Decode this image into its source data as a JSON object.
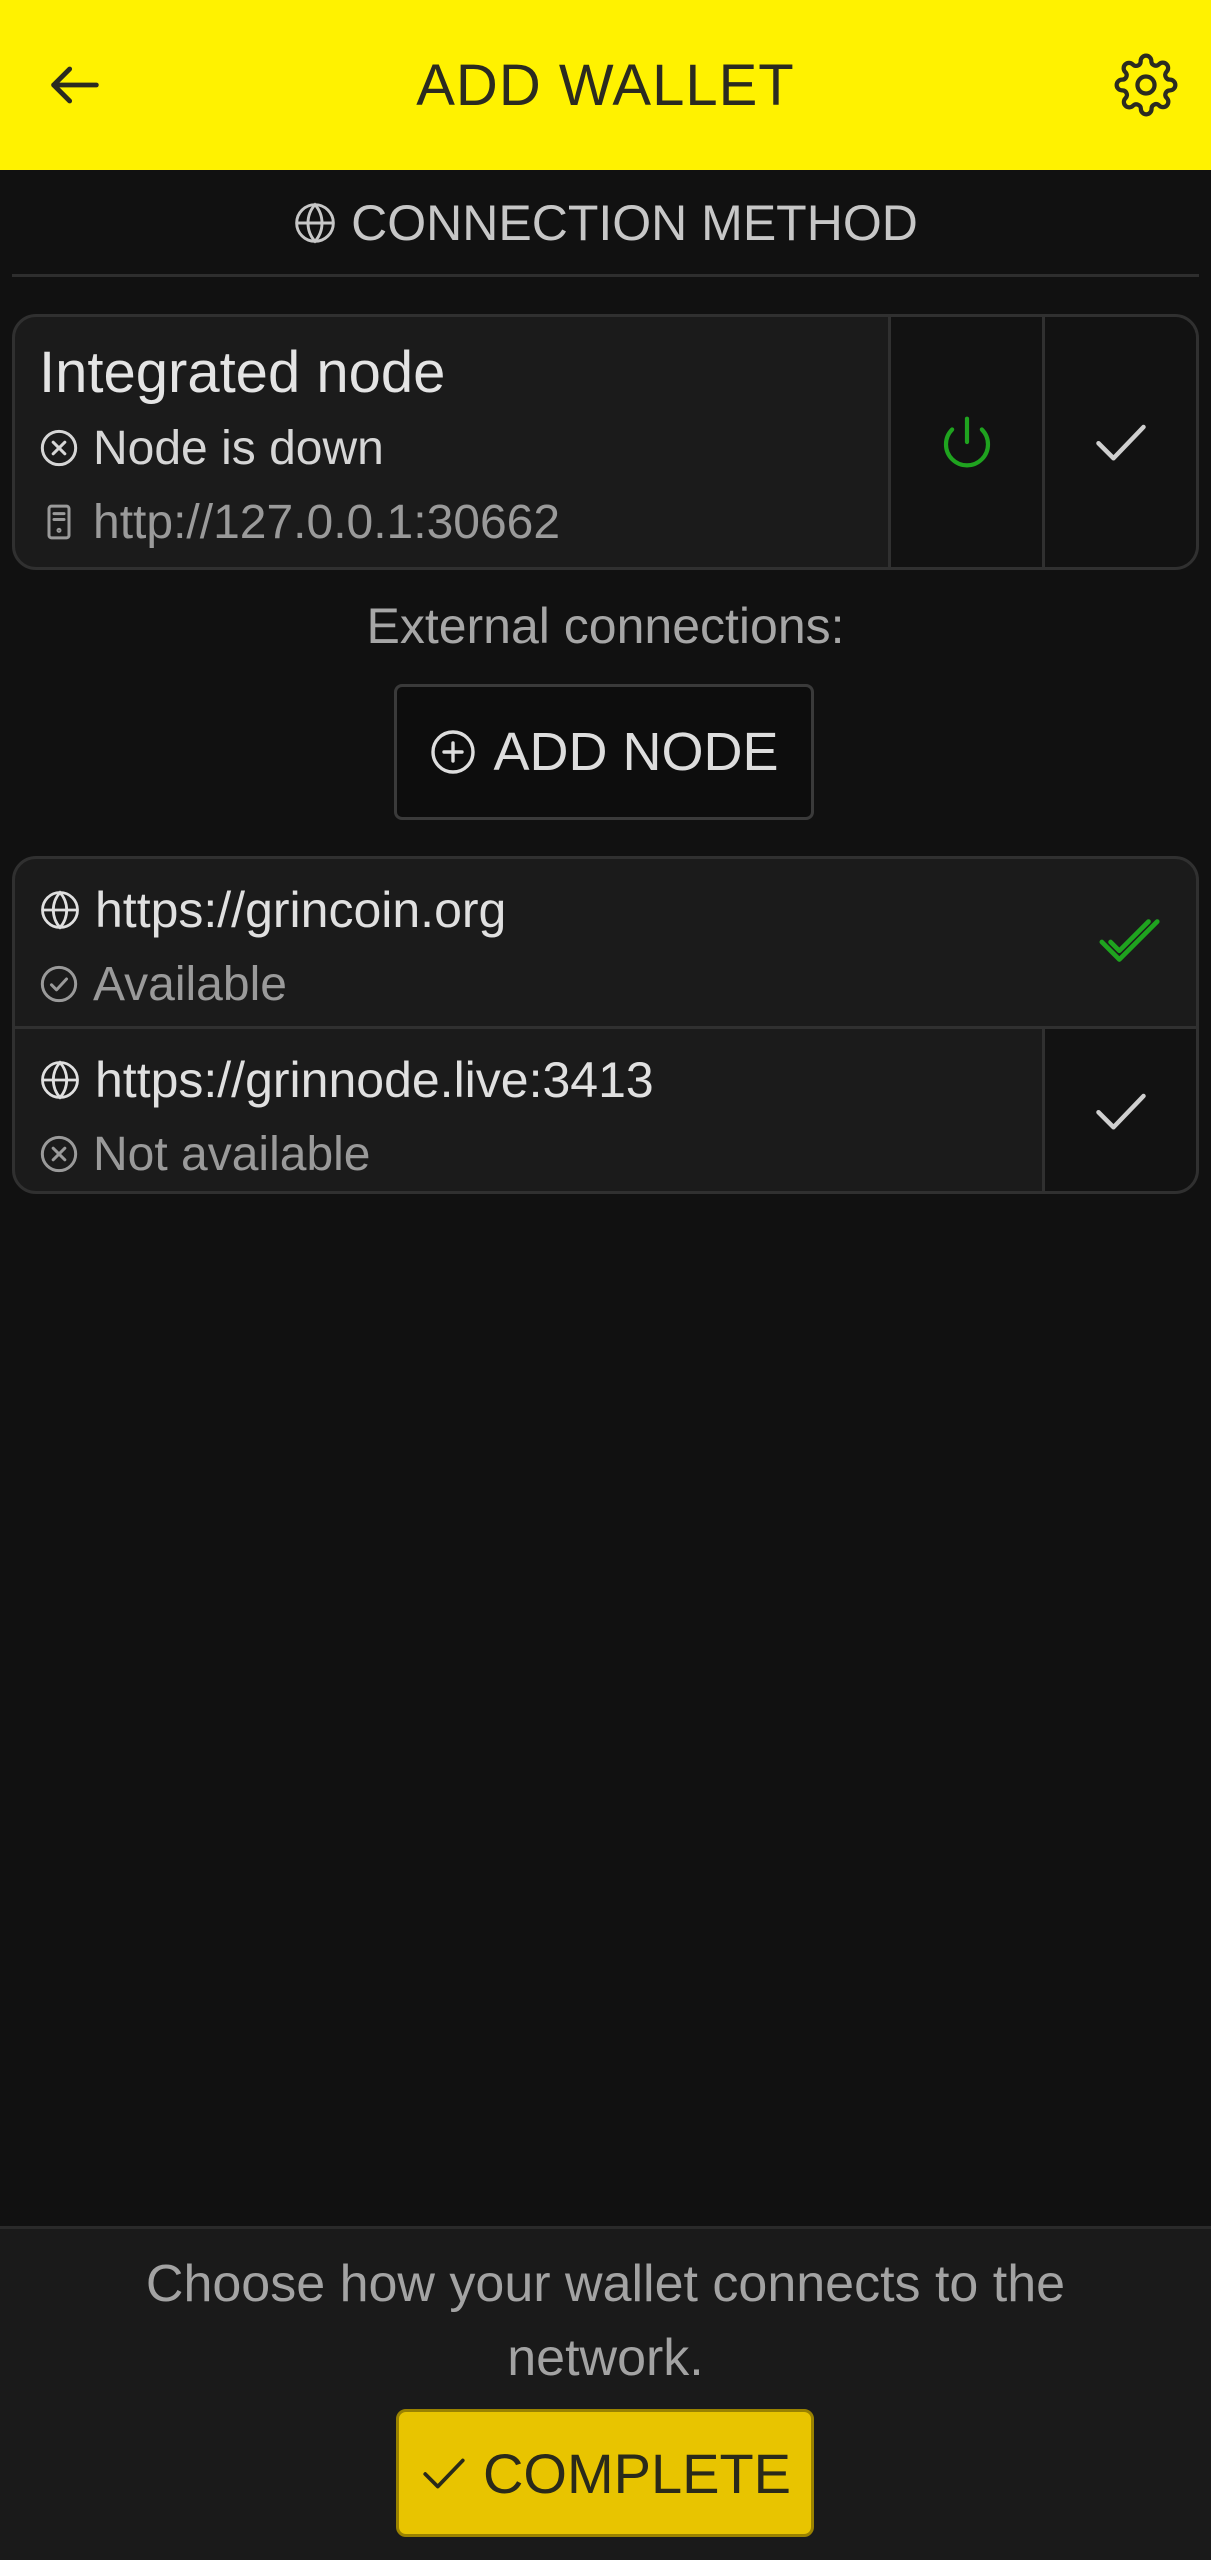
{
  "header": {
    "title": "ADD WALLET",
    "back_icon": "arrow-left-icon",
    "settings_icon": "gear-icon",
    "background": "#fff200"
  },
  "section": {
    "icon": "globe-icon",
    "title": "CONNECTION METHOD"
  },
  "integrated_node": {
    "title": "Integrated node",
    "status": "Node is down",
    "status_icon": "x-circle-icon",
    "address": "http://127.0.0.1:30662",
    "address_icon": "server-icon",
    "power_icon": "power-icon",
    "select_icon": "check-icon",
    "power_color": "#1fa31f"
  },
  "external": {
    "label": "External connections:",
    "add_button_label": "ADD NODE",
    "add_button_icon": "plus-circle-icon"
  },
  "nodes": [
    {
      "url": "https://grincoin.org",
      "status": "Available",
      "status_icon": "check-circle-icon",
      "selected": true,
      "check_color": "#1fa31f"
    },
    {
      "url": "https://grinnode.live:3413",
      "status": "Not available",
      "status_icon": "x-circle-icon",
      "selected": false
    }
  ],
  "footer": {
    "hint": "Choose how your wallet connects to the network.",
    "complete_label": "COMPLETE",
    "complete_icon": "check-icon",
    "accent": "#e8c400"
  }
}
